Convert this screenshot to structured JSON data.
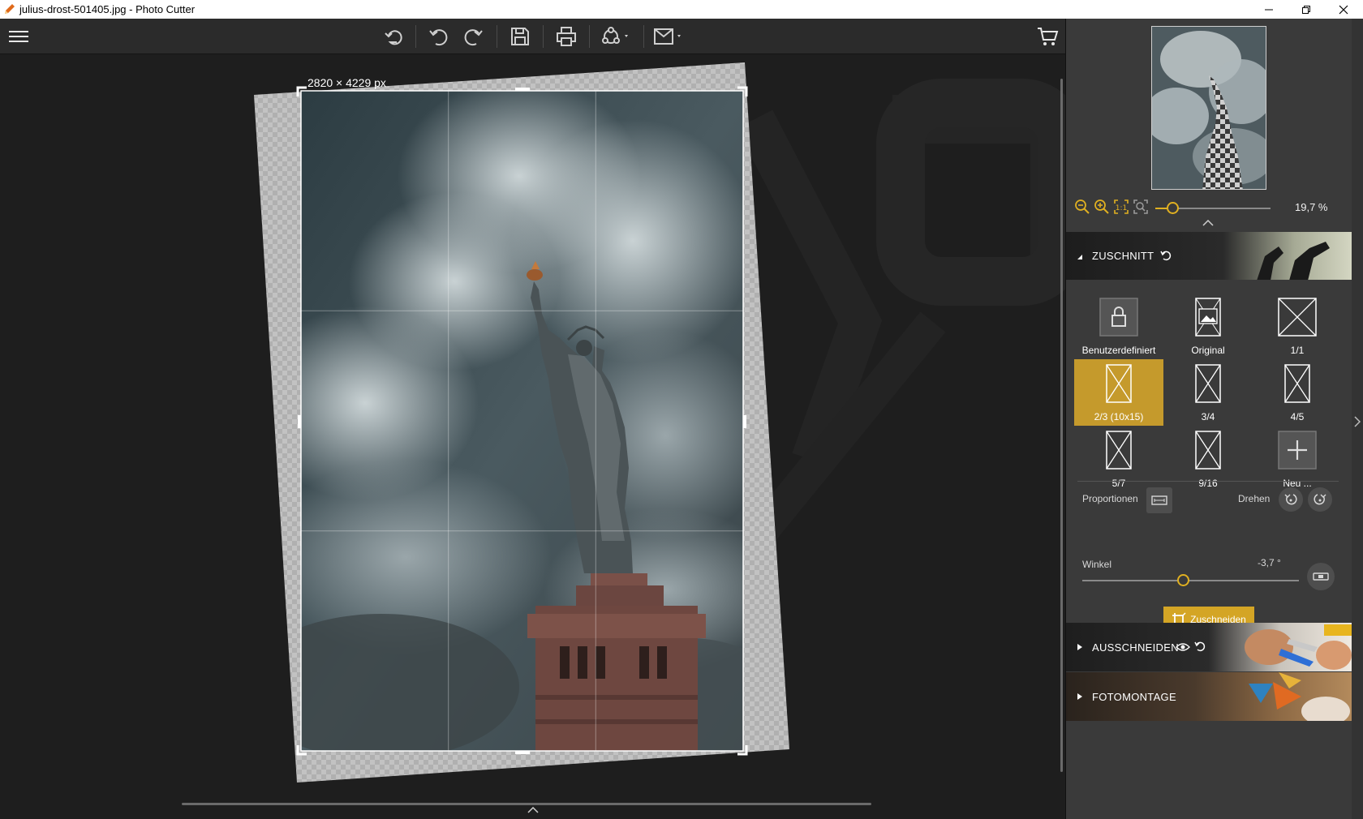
{
  "window": {
    "title": "julius-drost-501405.jpg - Photo Cutter"
  },
  "toolbar": {
    "buttons": [
      "menu-icon",
      "undo-all-icon",
      "undo-icon",
      "redo-icon",
      "save-icon",
      "print-icon",
      "share-icon",
      "export-icon",
      "cart-icon"
    ]
  },
  "canvas": {
    "size_label": "2820 × 4229 px"
  },
  "zoom": {
    "value": "19,7 %"
  },
  "sections": {
    "crop": {
      "label": "ZUSCHNITT"
    },
    "cutout": {
      "label": "AUSSCHNEIDEN"
    },
    "montage": {
      "label": "FOTOMONTAGE"
    }
  },
  "ratios": [
    {
      "label": "Benutzerdefiniert",
      "icon": "lock-icon",
      "selected": false
    },
    {
      "label": "Original",
      "icon": "image-icon",
      "selected": false
    },
    {
      "label": "1/1",
      "icon": "square-crop-icon",
      "selected": false
    },
    {
      "label": "2/3 (10x15)",
      "icon": "portrait-crop-icon",
      "selected": true
    },
    {
      "label": "3/4",
      "icon": "portrait-crop-icon",
      "selected": false
    },
    {
      "label": "4/5",
      "icon": "portrait-crop-icon",
      "selected": false
    },
    {
      "label": "5/7",
      "icon": "portrait-crop-icon",
      "selected": false
    },
    {
      "label": "9/16",
      "icon": "portrait-crop-icon",
      "selected": false
    },
    {
      "label": "Neu ...",
      "icon": "plus-icon",
      "selected": false
    }
  ],
  "controls": {
    "proportions_label": "Proportionen",
    "rotate_label": "Drehen",
    "angle_label": "Winkel",
    "angle_value": "-3,7 °",
    "crop_button": "Zuschneiden"
  },
  "colors": {
    "accent": "#d4a525",
    "selected_tile": "#c59a2c",
    "panel_bg": "#3a3a3a",
    "canvas_bg": "#1e1e1e"
  }
}
